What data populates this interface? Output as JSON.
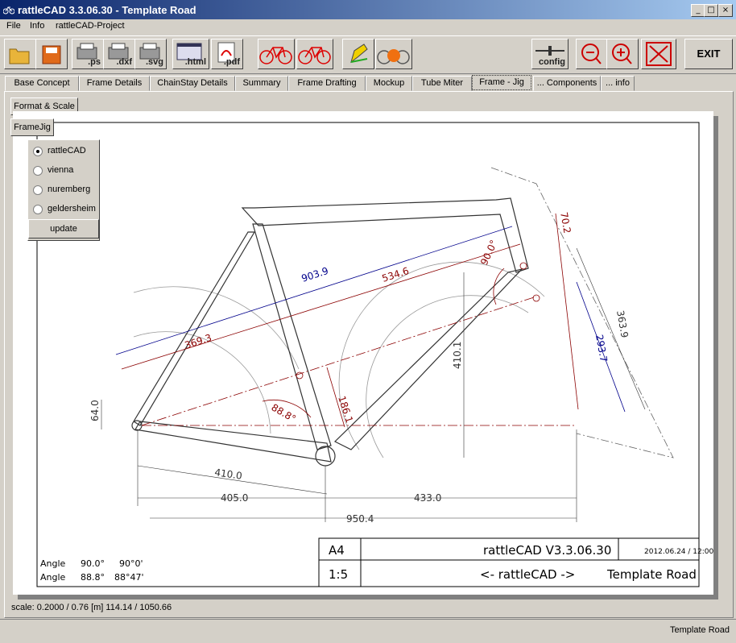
{
  "window": {
    "title": "rattleCAD  3.3.06.30 - Template Road",
    "min": "_",
    "max": "□",
    "close": "×"
  },
  "menu": [
    "File",
    "Info",
    "rattleCAD-Project"
  ],
  "toolbar": {
    "ps": ".ps",
    "dxf": ".dxf",
    "svg": ".svg",
    "html": ".html",
    "pdf": ".pdf",
    "config": "config",
    "exit": "EXIT"
  },
  "tabs": [
    "Base Concept",
    "Frame Details",
    "ChainStay Details",
    "Summary",
    "Frame Drafting",
    "Mockup",
    "Tube Miter",
    "Frame - Jig",
    "... Components",
    "... info"
  ],
  "subtabs": {
    "format": "Format & Scale",
    "framejig": "FrameJig"
  },
  "jig_options": [
    "rattleCAD",
    "vienna",
    "nuremberg",
    "geldersheim"
  ],
  "jig_selected": "rattleCAD",
  "update_label": "update",
  "drawing": {
    "dims": {
      "d903": "903.9",
      "d534": "534.6",
      "d369": "369.3",
      "d410v": "410.1",
      "d186": "186.1",
      "d88": "88.8°",
      "d90": "90.0°",
      "d64": "64.0",
      "d410h": "410.0",
      "d405": "405.0",
      "d433": "433.0",
      "d950": "950.4",
      "d70": "70.2",
      "d363": "363.9",
      "d293": "293.7"
    },
    "angles": {
      "label": "Angle",
      "r1": [
        "90.0°",
        "90°0'"
      ],
      "r2": [
        "88.8°",
        "88°47'"
      ]
    },
    "title_block": {
      "size": "A4",
      "scale": "1:5",
      "app": "rattleCAD   V3.3.06.30",
      "date": "2012.06.24 / 12:00",
      "subtitle": "<- rattleCAD ->",
      "project": "Template Road"
    }
  },
  "status_line": "scale: 0.2000 / 0.76  [m]  114.14 / 1050.66",
  "statusbar_right": "Template Road"
}
